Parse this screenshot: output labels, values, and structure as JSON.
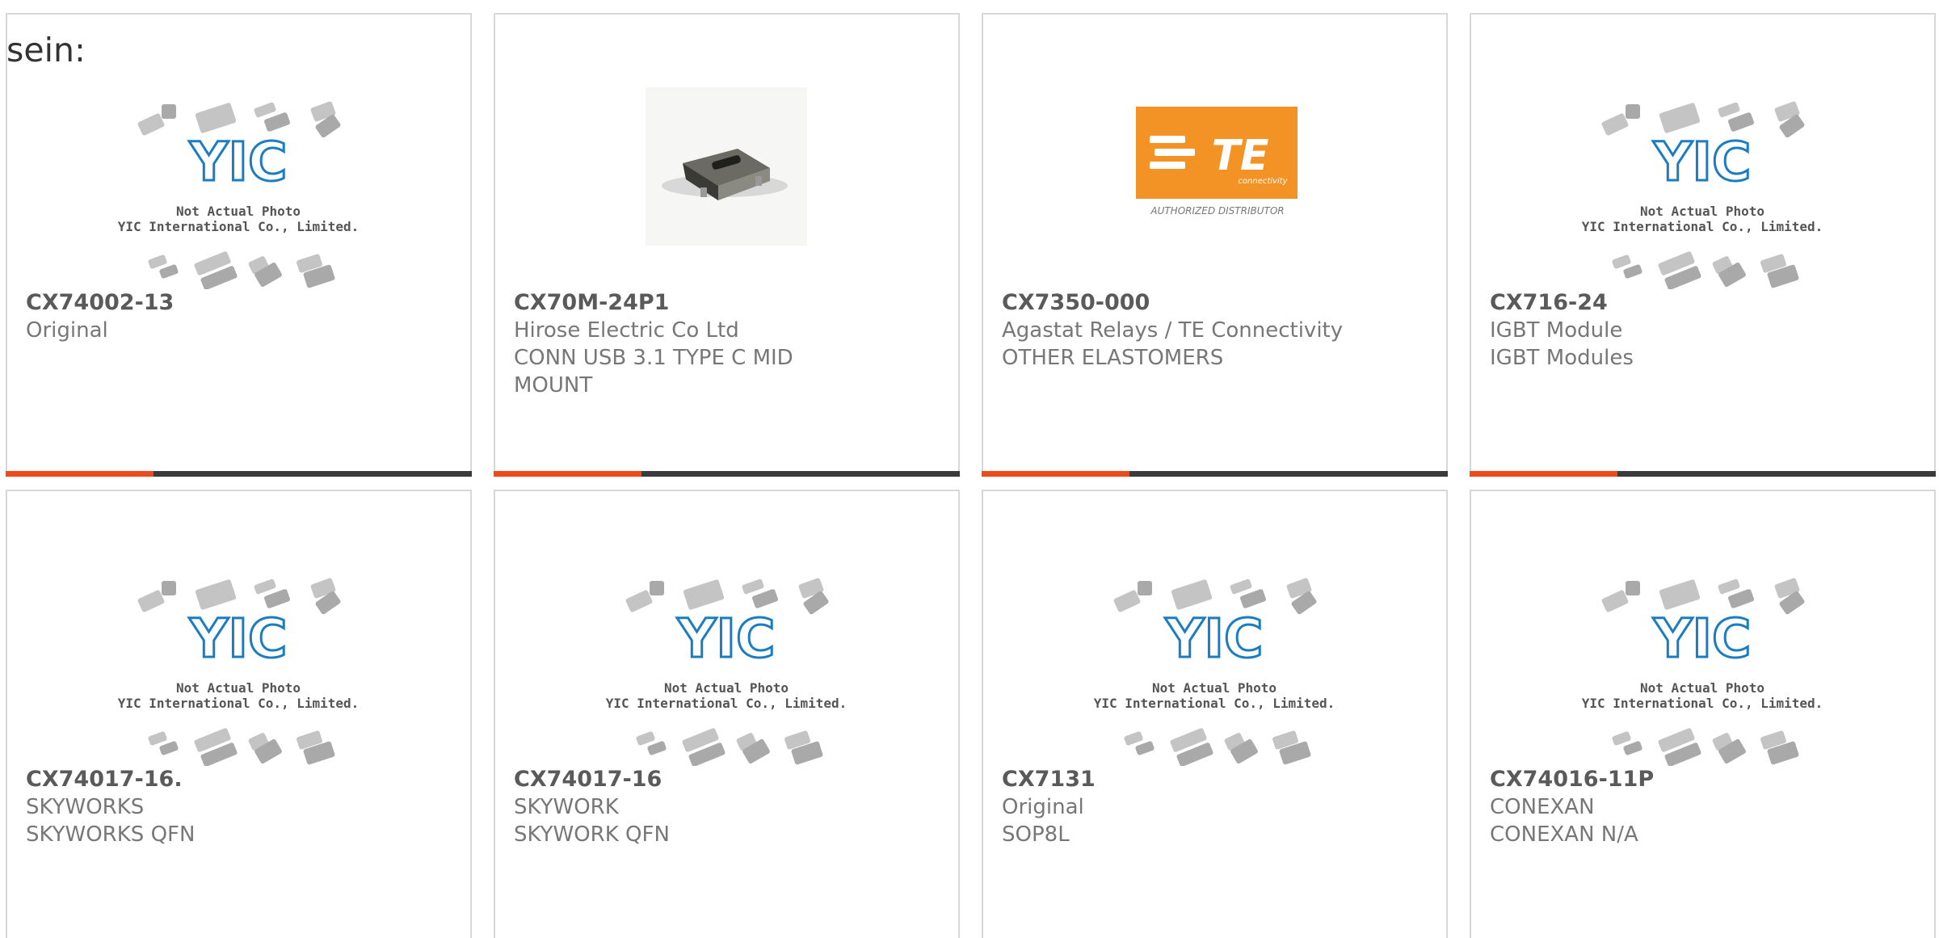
{
  "page": {
    "cut_off_text": "sein:"
  },
  "placeholder": {
    "line1": "Not Actual Photo",
    "line2": "YIC International Co., Limited.",
    "brand": "YIC"
  },
  "te_logo": {
    "mark": "TE",
    "sub": "connectivity",
    "tagline": "AUTHORIZED DISTRIBUTOR",
    "color": "#f39325"
  },
  "colors": {
    "accent": "#ee4b1c",
    "bar_dark": "#3b3b3b",
    "yic_blue": "#1a7cc1"
  },
  "cards": [
    {
      "part": "CX74002-13",
      "lines": [
        "Original"
      ],
      "image": "yic-placeholder"
    },
    {
      "part": "CX70M-24P1",
      "lines": [
        "Hirose Electric Co Ltd",
        "CONN USB 3.1 TYPE C MID",
        "MOUNT"
      ],
      "image": "usb-c-connector-photo"
    },
    {
      "part": "CX7350-000",
      "lines": [
        "Agastat Relays / TE Connectivity",
        "OTHER ELASTOMERS"
      ],
      "image": "te-connectivity-logo"
    },
    {
      "part": "CX716-24",
      "lines": [
        "IGBT Module",
        "IGBT Modules"
      ],
      "image": "yic-placeholder"
    },
    {
      "part": "CX74017-16.",
      "lines": [
        "SKYWORKS",
        "SKYWORKS QFN"
      ],
      "image": "yic-placeholder"
    },
    {
      "part": "CX74017-16",
      "lines": [
        "SKYWORK",
        "SKYWORK QFN"
      ],
      "image": "yic-placeholder"
    },
    {
      "part": "CX7131",
      "lines": [
        "Original",
        "SOP8L"
      ],
      "image": "yic-placeholder"
    },
    {
      "part": "CX74016-11P",
      "lines": [
        "CONEXAN",
        "CONEXAN N/A"
      ],
      "image": "yic-placeholder"
    }
  ]
}
